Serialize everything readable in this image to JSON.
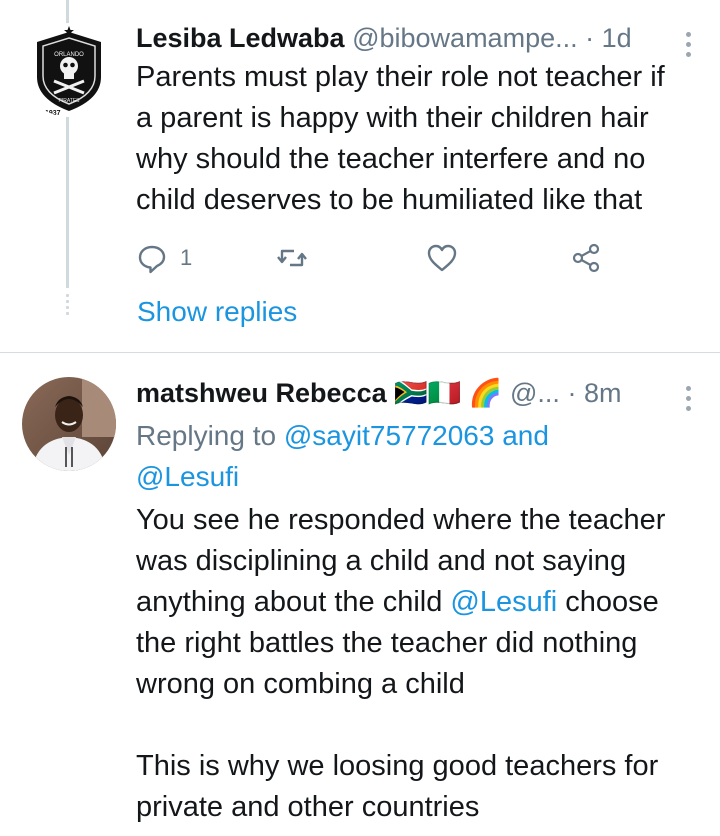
{
  "tweet1": {
    "name": "Lesiba Ledwaba",
    "handle": "@bibowamampe...",
    "separator": "·",
    "time": "1d",
    "text": "Parents must play their role not teacher if\na parent is happy with their children hair\nwhy should the teacher interfere and no\nchild deserves to be humiliated like that",
    "reply_count": "1",
    "show_replies": "Show replies",
    "avatar_label": "ORLANDO PIRATES 1937"
  },
  "tweet2": {
    "name": "matshweu Rebecca",
    "flags": "🇿🇦🇮🇹 🌈",
    "handle": "@...",
    "separator": "·",
    "time": "8m",
    "replying_prefix": "Replying to",
    "replying_user1": "@sayit75772063",
    "replying_and": "and",
    "replying_user2": "@Lesufi",
    "text_part1": "You see he responded where the teacher\nwas disciplining a child and not saying\nanything about the child ",
    "text_mention": "@Lesufi",
    "text_part2": " choose\nthe right battles the teacher did nothing\nwrong on combing a child\n\nThis is why we loosing good teachers for\nprivate and other countries"
  }
}
